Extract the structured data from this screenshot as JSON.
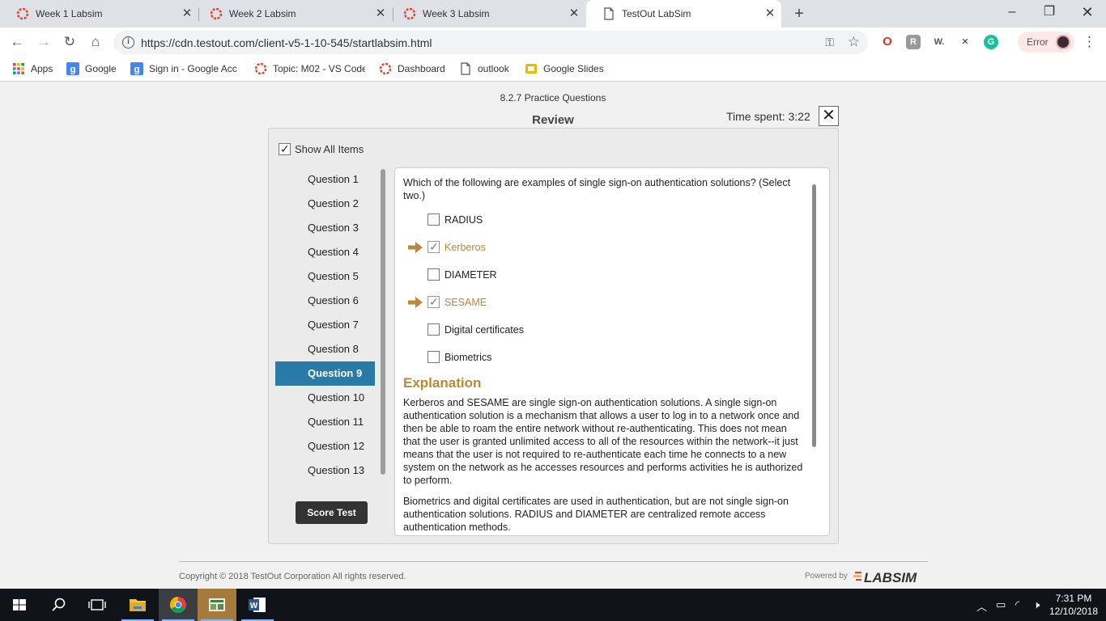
{
  "browser": {
    "tabs": [
      {
        "title": "Week 1 Labsim",
        "active": false
      },
      {
        "title": "Week 2 Labsim",
        "active": false
      },
      {
        "title": "Week 3 Labsim",
        "active": false
      },
      {
        "title": "TestOut LabSim",
        "active": true
      }
    ],
    "url": "https://cdn.testout.com/client-v5-1-10-545/startlabsim.html",
    "error_label": "Error",
    "bookmarks": [
      {
        "label": "Apps",
        "icon": "apps-grid-icon"
      },
      {
        "label": "Google",
        "icon": "google-icon"
      },
      {
        "label": "Sign in - Google Acc",
        "icon": "google-icon"
      },
      {
        "label": "Topic: M02 - VS Code",
        "icon": "labsim-icon"
      },
      {
        "label": "Dashboard",
        "icon": "labsim-icon"
      },
      {
        "label": "outlook",
        "icon": "page-icon"
      },
      {
        "label": "Google Slides",
        "icon": "slides-icon"
      }
    ]
  },
  "header": {
    "exam_title": "8.2.7 Practice Questions",
    "review_title": "Review",
    "time_spent": "Time spent: 3:22"
  },
  "panel": {
    "show_all_label": "Show All Items",
    "show_all_checked": true,
    "questions": [
      "Question 1",
      "Question 2",
      "Question 3",
      "Question 4",
      "Question 5",
      "Question 6",
      "Question 7",
      "Question 8",
      "Question 9",
      "Question 10",
      "Question 11",
      "Question 12",
      "Question 13"
    ],
    "active_question": "Question 9",
    "score_button": "Score Test"
  },
  "question": {
    "text": "Which of the following are examples of single sign-on authentication solutions? (Select two.)",
    "answers": [
      {
        "label": "RADIUS",
        "checked": false,
        "correct": false
      },
      {
        "label": "Kerberos",
        "checked": true,
        "correct": true
      },
      {
        "label": "DIAMETER",
        "checked": false,
        "correct": false
      },
      {
        "label": "SESAME",
        "checked": true,
        "correct": true
      },
      {
        "label": "Digital certificates",
        "checked": false,
        "correct": false
      },
      {
        "label": "Biometrics",
        "checked": false,
        "correct": false
      }
    ],
    "explanation_heading": "Explanation",
    "explanation_p1": "Kerberos and SESAME are single sign-on authentication solutions. A single sign-on authentication solution is a mechanism that allows a user to log in to a network once and then be able to roam the entire network without re-authenticating. This does not mean that the user is granted unlimited access to all of the resources within the network--it just means that the user is not required to re-authenticate each time he connects to a new system on the network as he accesses resources and performs activities he is authorized to perform.",
    "explanation_p2": "Biometrics and digital certificates are used in authentication, but are not single sign-on authentication solutions. RADIUS and DIAMETER are centralized remote access authentication methods."
  },
  "footer": {
    "copyright": "Copyright © 2018  TestOut Corporation All rights reserved.",
    "powered_by": "Powered by",
    "logo_text": "LABSIM"
  },
  "taskbar": {
    "time": "7:31 PM",
    "date": "12/10/2018"
  },
  "colors": {
    "accent_blue": "#2a7aa8",
    "correct_gold": "#b8893a",
    "labsim_red": "#e0452f"
  }
}
